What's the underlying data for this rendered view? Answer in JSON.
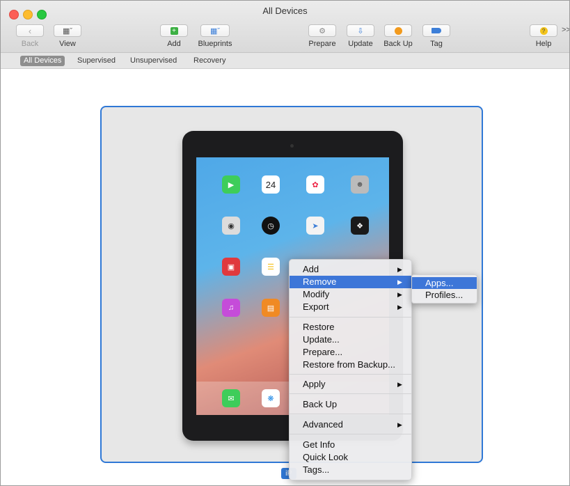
{
  "window": {
    "title": "All Devices"
  },
  "toolbar": {
    "back": "Back",
    "view": "View",
    "add": "Add",
    "blueprints": "Blueprints",
    "prepare": "Prepare",
    "update": "Update",
    "backup": "Back Up",
    "tag": "Tag",
    "help": "Help",
    "overflow": ">>"
  },
  "tabs": [
    {
      "label": "All Devices",
      "active": true
    },
    {
      "label": "Supervised"
    },
    {
      "label": "Unsupervised"
    },
    {
      "label": "Recovery"
    }
  ],
  "device": {
    "label": "iP",
    "calendar_day": "24"
  },
  "context_menu": {
    "items": [
      {
        "label": "Add",
        "submenu": true
      },
      {
        "label": "Remove",
        "submenu": true,
        "highlighted": true
      },
      {
        "label": "Modify",
        "submenu": true
      },
      {
        "label": "Export",
        "submenu": true
      },
      {
        "label": "Restore"
      },
      {
        "label": "Update..."
      },
      {
        "label": "Prepare..."
      },
      {
        "label": "Restore from Backup..."
      },
      {
        "label": "Apply",
        "submenu": true
      },
      {
        "label": "Back Up"
      },
      {
        "label": "Advanced",
        "submenu": true
      },
      {
        "label": "Get Info"
      },
      {
        "label": "Quick Look"
      },
      {
        "label": "Tags..."
      }
    ],
    "arrow": "▶"
  },
  "submenu": {
    "items": [
      {
        "label": "Apps...",
        "highlighted": true
      },
      {
        "label": "Profiles..."
      }
    ]
  },
  "colors": {
    "accent": "#2f78d6",
    "highlight": "#3d76d8"
  }
}
